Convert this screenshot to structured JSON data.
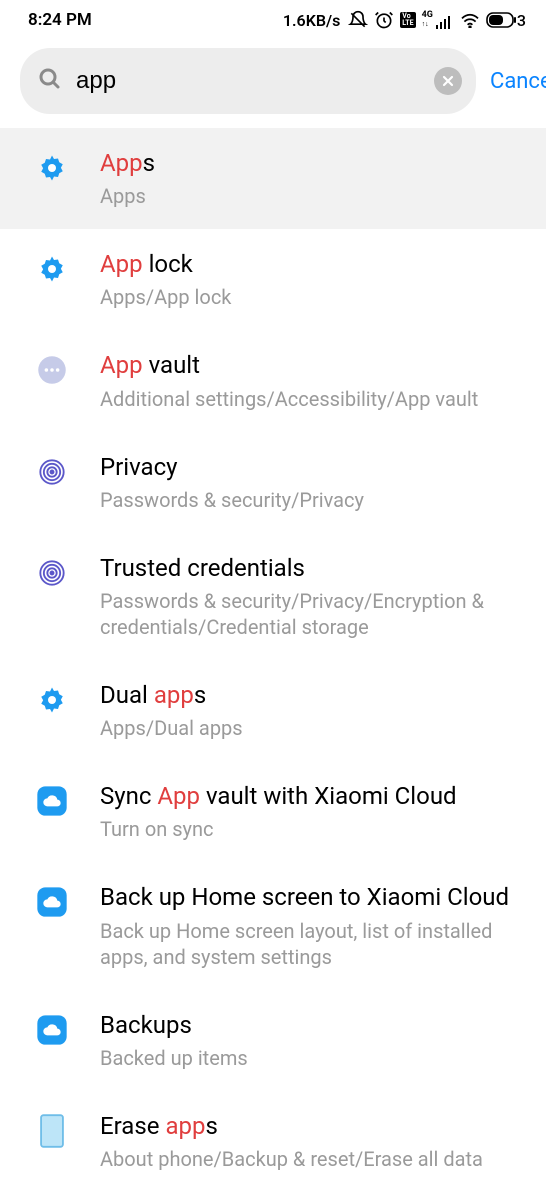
{
  "status": {
    "time": "8:24 PM",
    "speed": "1.6KB/s",
    "net_label": "4G",
    "lte_label": "Vo LTE",
    "battery_text": "3"
  },
  "search": {
    "value": "app",
    "cancel": "Cancel"
  },
  "results": [
    {
      "icon": "gear",
      "title_parts": [
        [
          "App",
          "hl"
        ],
        [
          "s",
          ""
        ]
      ],
      "sub": "Apps",
      "selected": true
    },
    {
      "icon": "gear",
      "title_parts": [
        [
          "App",
          "hl"
        ],
        [
          " lock",
          ""
        ]
      ],
      "sub": "Apps/App lock"
    },
    {
      "icon": "dots",
      "title_parts": [
        [
          "App",
          "hl"
        ],
        [
          " vault",
          ""
        ]
      ],
      "sub": "Additional settings/Accessibility/App vault"
    },
    {
      "icon": "fingerprint",
      "title_parts": [
        [
          "Privacy",
          ""
        ]
      ],
      "sub": "Passwords & security/Privacy"
    },
    {
      "icon": "fingerprint",
      "title_parts": [
        [
          "Trusted credentials",
          ""
        ]
      ],
      "sub": "Passwords & security/Privacy/Encryption & credentials/Credential storage"
    },
    {
      "icon": "gear",
      "title_parts": [
        [
          "Dual ",
          ""
        ],
        [
          "app",
          "hl"
        ],
        [
          "s",
          ""
        ]
      ],
      "sub": "Apps/Dual apps"
    },
    {
      "icon": "cloud",
      "title_parts": [
        [
          "Sync ",
          ""
        ],
        [
          "App",
          "hl"
        ],
        [
          " vault with Xiaomi Cloud",
          ""
        ]
      ],
      "sub": "Turn on sync"
    },
    {
      "icon": "cloud",
      "title_parts": [
        [
          "Back up Home screen to Xiaomi Cloud",
          ""
        ]
      ],
      "sub": "Back up Home screen layout, list of installed apps, and system settings"
    },
    {
      "icon": "cloud",
      "title_parts": [
        [
          "Backups",
          ""
        ]
      ],
      "sub": "Backed up items"
    },
    {
      "icon": "rect",
      "title_parts": [
        [
          "Erase ",
          ""
        ],
        [
          "app",
          "hl"
        ],
        [
          "s",
          ""
        ]
      ],
      "sub": "About phone/Backup & reset/Erase all data"
    }
  ]
}
